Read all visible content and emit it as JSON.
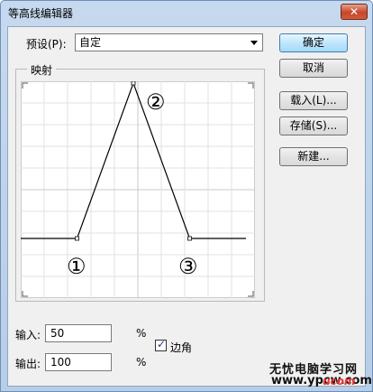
{
  "window": {
    "title": "等高线编辑器",
    "close_glyph": "✕"
  },
  "preset": {
    "label": "预设(P):",
    "value": "自定"
  },
  "mapping": {
    "group_label": "映射",
    "annotations": [
      "②",
      "①",
      "③"
    ],
    "points": [
      [
        0,
        0
      ],
      [
        25,
        0
      ],
      [
        50,
        100
      ],
      [
        75,
        0
      ],
      [
        100,
        0
      ]
    ]
  },
  "buttons": {
    "ok": "确定",
    "cancel": "取消",
    "load": "载入(L)...",
    "save": "存储(S)...",
    "new": "新建..."
  },
  "input": {
    "label": "输入:",
    "value": "50",
    "unit": "%"
  },
  "output": {
    "label": "输出:",
    "value": "100",
    "unit": "%"
  },
  "corner": {
    "label": "边角",
    "checked": true,
    "check_glyph": "✓"
  },
  "watermark": {
    "line1": "无忧电脑学习网",
    "line2": "www.ypcw.com",
    "line3": "ucom"
  }
}
